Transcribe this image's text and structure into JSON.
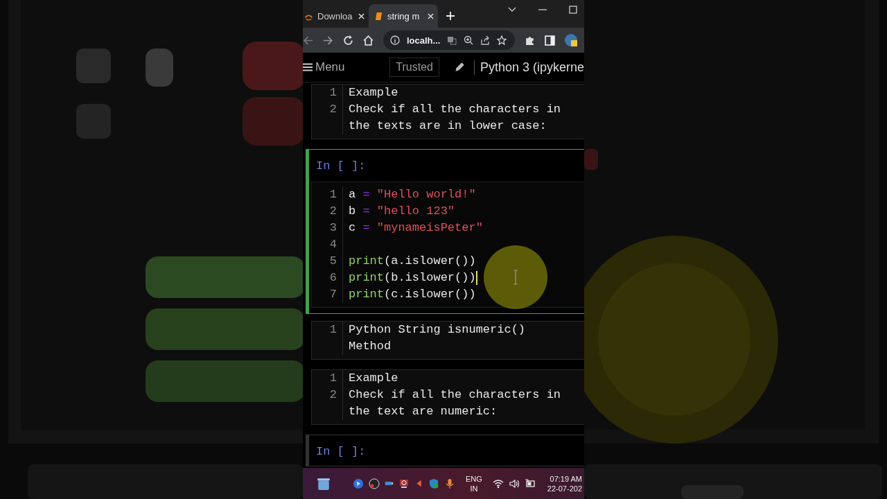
{
  "browser": {
    "tabs": [
      {
        "title": "Downloa",
        "selected": false
      },
      {
        "title": "string m",
        "selected": true
      }
    ],
    "address": "localh..."
  },
  "notebook_toolbar": {
    "menu": "Menu",
    "trusted": "Trusted",
    "kernel": "Python 3 (ipykerne"
  },
  "cells": [
    {
      "kind": "markdown",
      "selected": false,
      "lines": [
        {
          "number": "1",
          "text": "Example"
        },
        {
          "number": "2",
          "text": "Check if all the characters in the texts are in lower case:"
        }
      ]
    },
    {
      "kind": "code",
      "selected": true,
      "prompt": "In [ ]:",
      "lines": [
        {
          "number": "1",
          "cursor": false,
          "tokens": [
            {
              "kind": "name",
              "text": "a "
            },
            {
              "kind": "op",
              "text": "="
            },
            {
              "kind": "str",
              "text": " \"Hello world!\""
            }
          ]
        },
        {
          "number": "2",
          "cursor": false,
          "tokens": [
            {
              "kind": "name",
              "text": "b "
            },
            {
              "kind": "op",
              "text": "="
            },
            {
              "kind": "str",
              "text": " \"hello 123\""
            }
          ]
        },
        {
          "number": "3",
          "cursor": false,
          "tokens": [
            {
              "kind": "name",
              "text": "c "
            },
            {
              "kind": "op",
              "text": "="
            },
            {
              "kind": "str",
              "text": " \"mynameisPeter\""
            }
          ]
        },
        {
          "number": "4",
          "cursor": false
        },
        {
          "number": "5",
          "cursor": false,
          "tokens": [
            {
              "kind": "builtin",
              "text": "print"
            },
            {
              "kind": "name",
              "text": "(a.islower())"
            }
          ]
        },
        {
          "number": "6",
          "cursor": true,
          "tokens": [
            {
              "kind": "builtin",
              "text": "print"
            },
            {
              "kind": "name",
              "text": "(b.islower())"
            }
          ]
        },
        {
          "number": "7",
          "cursor": false,
          "tokens": [
            {
              "kind": "builtin",
              "text": "print"
            },
            {
              "kind": "name",
              "text": "(c.islower())"
            }
          ]
        }
      ]
    },
    {
      "kind": "markdown",
      "selected": false,
      "lines": [
        {
          "number": "1",
          "text": "Python String isnumeric() Method"
        }
      ]
    },
    {
      "kind": "markdown",
      "selected": false,
      "lines": [
        {
          "number": "1",
          "text": "Example"
        },
        {
          "number": "2",
          "text": "Check if all the characters in the text are numeric:"
        }
      ]
    },
    {
      "kind": "code",
      "selected": false,
      "prompt": "In [ ]:"
    }
  ],
  "taskbar": {
    "language": "ENG",
    "region": "IN",
    "time": "07:19 AM",
    "date": "22-07-202"
  }
}
